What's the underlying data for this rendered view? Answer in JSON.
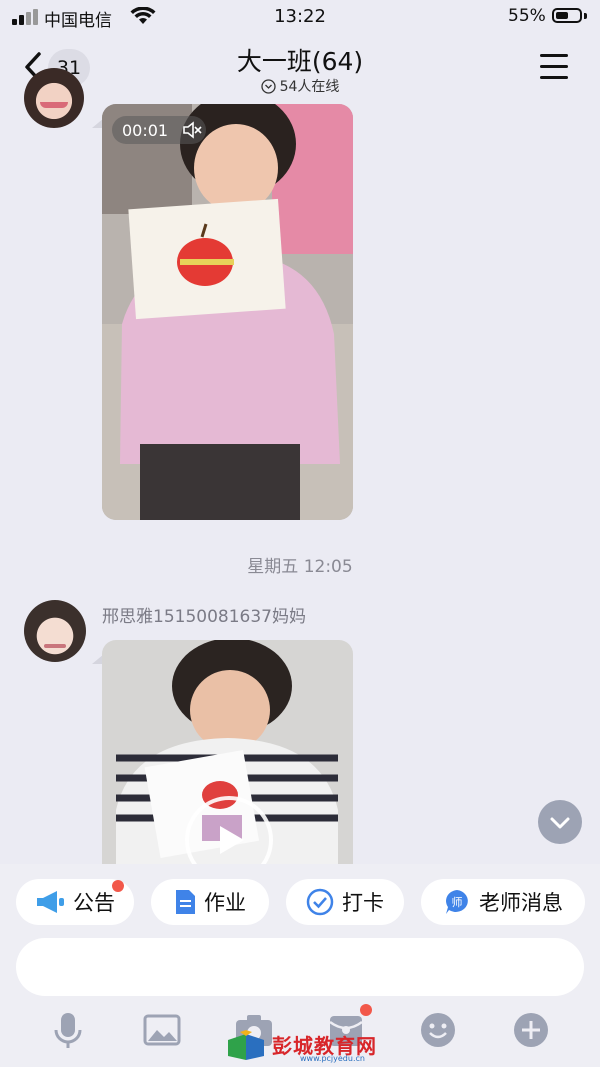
{
  "status": {
    "carrier": "中国电信",
    "time": "13:22",
    "battery": "55%",
    "battery_level": 0.55
  },
  "header": {
    "back_count": "31",
    "title": "大一班(64)",
    "online": "54人在线"
  },
  "messages": {
    "video1_duration": "00:01",
    "timestamp": "星期五 12:05",
    "sender": "邢思雅15150081637妈妈"
  },
  "quick_actions": [
    {
      "label": "公告",
      "icon": "megaphone-icon",
      "badge": true
    },
    {
      "label": "作业",
      "icon": "document-icon",
      "badge": false
    },
    {
      "label": "打卡",
      "icon": "checkin-icon",
      "badge": false
    },
    {
      "label": "老师消息",
      "icon": "teacher-icon",
      "badge": false
    }
  ],
  "toolbar": [
    "microphone-icon",
    "image-icon",
    "camera-icon",
    "red-packet-icon",
    "emoji-icon",
    "plus-icon"
  ],
  "watermark": {
    "name": "彭城教育网",
    "url": "www.pcjyedu.cn"
  },
  "colors": {
    "accent": "#3f83e8",
    "badge": "#f2584a",
    "background": "#ebebf3"
  }
}
